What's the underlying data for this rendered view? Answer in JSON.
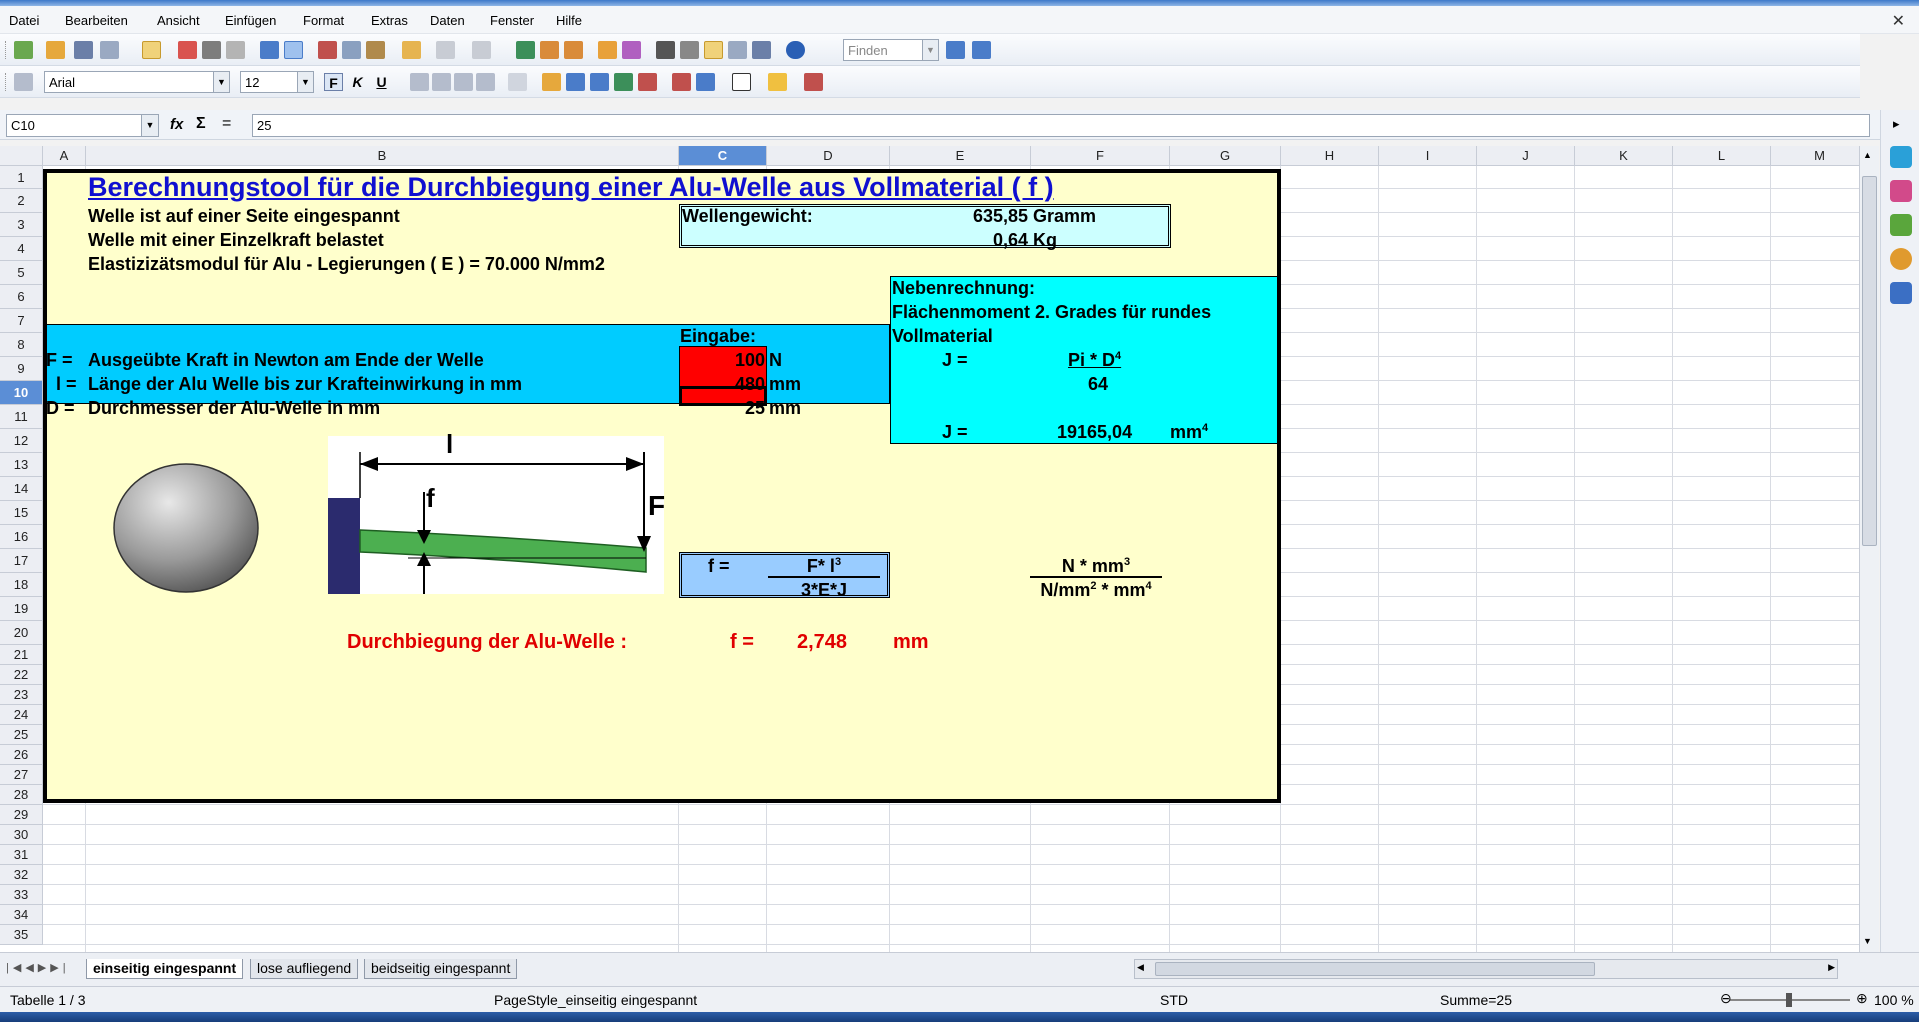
{
  "menu": [
    "Datei",
    "Bearbeiten",
    "Ansicht",
    "Einfügen",
    "Format",
    "Extras",
    "Daten",
    "Fenster",
    "Hilfe"
  ],
  "toolbar": {
    "find_placeholder": "Finden",
    "font_name": "Arial",
    "font_size": "12",
    "bold": "F",
    "italic": "K",
    "underline": "U"
  },
  "formula": {
    "cell_ref": "C10",
    "content": "25",
    "fx": "fx",
    "sigma": "Σ",
    "equals": "="
  },
  "columns": [
    "A",
    "B",
    "C",
    "D",
    "E",
    "F",
    "G",
    "H",
    "I",
    "J",
    "K",
    "L",
    "M"
  ],
  "rows": [
    "1",
    "2",
    "3",
    "4",
    "5",
    "6",
    "7",
    "8",
    "9",
    "10",
    "11",
    "12",
    "13",
    "14",
    "15",
    "16",
    "17",
    "18",
    "19",
    "20",
    "21",
    "22",
    "23",
    "24",
    "25",
    "26",
    "27",
    "28",
    "29",
    "30",
    "31",
    "32",
    "33",
    "34",
    "35"
  ],
  "sheet": {
    "title": "Berechnungstool für die Durchbiegung einer Alu-Welle aus Vollmaterial ( f )",
    "line2": "Welle ist auf einer Seite eingespannt",
    "line3": "Welle mit einer Einzelkraft belastet",
    "line4": "Elastizizätsmodul für Alu - Legierungen ( E ) = 70.000 N/mm2",
    "weight_label": "Wellengewicht:",
    "weight_g": "635,85",
    "weight_g_unit": "Gramm",
    "weight_kg": "0,64",
    "weight_kg_unit": "Kg",
    "neben": "Nebenrechnung:",
    "flaechen": "Flächenmoment 2. Grades für rundes",
    "vollmaterial": "Vollmaterial",
    "j_label": "J =",
    "j_num": "Pi * D",
    "j_num_exp": "4",
    "j_den": "64",
    "j_label2": "J =",
    "j_value": "19165,04",
    "j_unit": "mm",
    "j_unit_exp": "4",
    "eingabe": "Eingabe:",
    "f_sym": "F =",
    "f_desc": "Ausgeübte Kraft in Newton am Ende der Welle",
    "f_val": "100",
    "f_unit": "N",
    "l_sym": "l =",
    "l_desc": "Länge der Alu Welle bis zur Krafteinwirkung in mm",
    "l_val": "480",
    "l_unit": "mm",
    "d_sym": "D =",
    "d_desc": "Durchmesser der Alu-Welle in mm",
    "d_val": "25",
    "d_unit": "mm",
    "formula_f": "f =",
    "formula_num": "F* l",
    "formula_num_exp": "3",
    "formula_den": "3*E*J",
    "unit_num": "N * mm",
    "unit_num_exp": "3",
    "unit_den_a": "N/mm",
    "unit_den_a_exp": "2",
    "unit_den_b": " * mm",
    "unit_den_b_exp": "4",
    "result_label": "Durchbiegung der Alu-Welle :",
    "result_f": "f =",
    "result_val": "2,748",
    "result_unit": "mm",
    "diag_l": "l",
    "diag_f": "f",
    "diag_F": "F"
  },
  "tabs": [
    "einseitig eingespannt",
    "lose aufliegend",
    "beidseitig eingespannt"
  ],
  "status": {
    "sheet": "Tabelle 1 / 3",
    "style": "PageStyle_einseitig eingespannt",
    "mode": "STD",
    "sum": "Summe=25",
    "zoom": "100 %"
  },
  "colors": {
    "title_blue": "#1010d0",
    "cell_yellow": "#ffffcc",
    "cell_cyan": "#00ffff",
    "cell_light_cyan": "#ccffff",
    "cell_blue": "#00ccff",
    "cell_red": "#ff0000",
    "result_red": "#e00000",
    "formula_blue": "#99ccff",
    "beam_green": "#4caf50"
  }
}
